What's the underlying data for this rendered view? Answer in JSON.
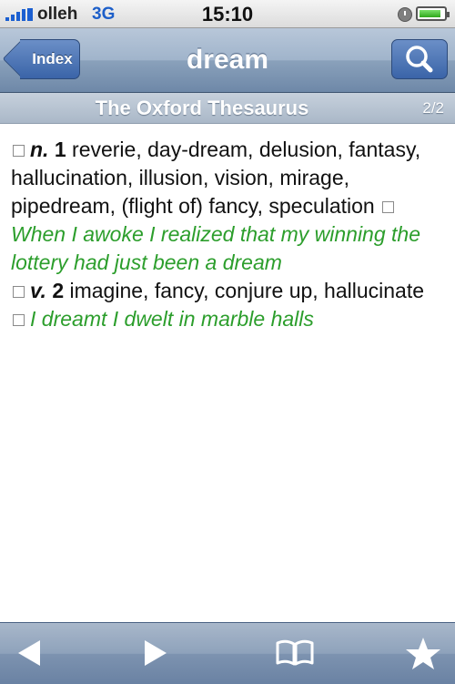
{
  "status_bar": {
    "carrier": "olleh",
    "network": "3G",
    "time": "15:10",
    "battery_level": 0.9
  },
  "nav_bar": {
    "back_label": "Index",
    "title": "dream",
    "search_icon": "search-icon"
  },
  "section_header": {
    "title": "The Oxford Thesaurus",
    "page_indicator": "2/2"
  },
  "entry": {
    "sense1": {
      "pos": "n.",
      "number": "1",
      "synonyms": "reverie, day-dream, delusion, fantasy, hallucination, illusion, vision, mirage, pipedream, (flight of) fancy, speculation",
      "example": "When I awoke I realized that my winning the lottery had just been a dream"
    },
    "sense2": {
      "pos": "v.",
      "number": "2",
      "synonyms": "imagine, fancy, conjure up, hallucinate",
      "example": "I dreamt I dwelt in marble halls"
    }
  },
  "toolbar": {
    "icons": [
      "back-arrow-icon",
      "forward-arrow-icon",
      "bookmarks-book-icon",
      "favorites-star-icon"
    ]
  },
  "colors": {
    "example_text": "#2c9e2c",
    "nav_button": "#3a64a8"
  }
}
